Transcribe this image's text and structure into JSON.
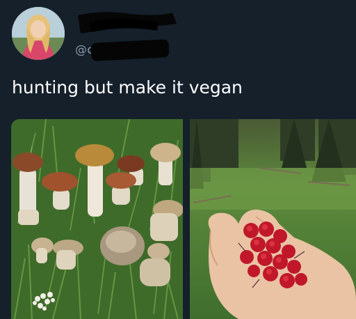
{
  "author": {
    "handle": "@c"
  },
  "tweet": {
    "text": "hunting but make it vegan"
  },
  "media": [
    {
      "kind": "photo",
      "subject": "mushrooms"
    },
    {
      "kind": "photo",
      "subject": "berries"
    }
  ]
}
